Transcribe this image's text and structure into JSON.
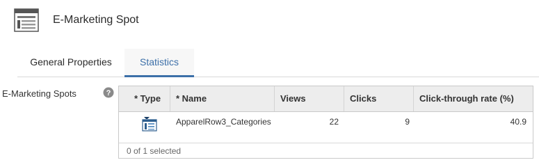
{
  "header": {
    "title": "E-Marketing Spot",
    "icon": "layout-grid-icon"
  },
  "tabs": [
    {
      "label": "General Properties",
      "active": false
    },
    {
      "label": "Statistics",
      "active": true
    }
  ],
  "field": {
    "label": "E-Marketing Spots",
    "help_icon": "help-icon"
  },
  "grid": {
    "columns": [
      "* Type",
      "* Name",
      "Views",
      "Clicks",
      "Click-through rate (%)"
    ],
    "rows": [
      {
        "type_icon": "e-marketing-spot-icon",
        "name": "ApparelRow3_Categories",
        "views": "22",
        "clicks": "9",
        "ctr": "40.9"
      }
    ],
    "footer": "0 of 1 selected"
  },
  "colors": {
    "accent": "#3c6fa8",
    "header_bg": "#ededed"
  }
}
